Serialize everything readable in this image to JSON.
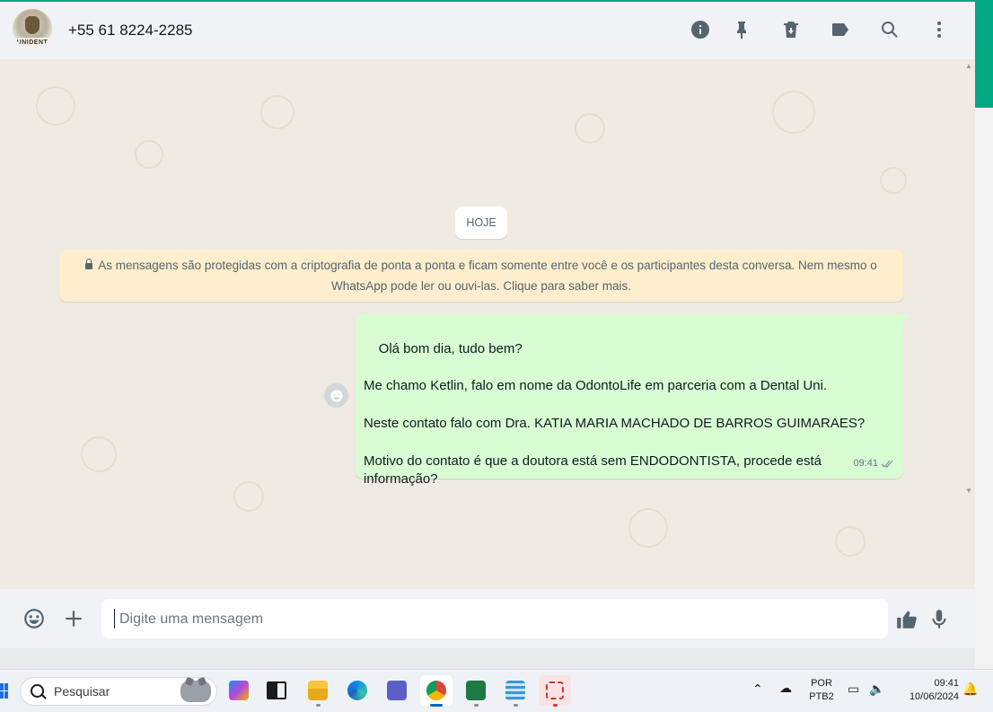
{
  "header": {
    "contact_name": "+55 61 8224-2285",
    "avatar_text": "UNIDENT",
    "icons": [
      "info-icon",
      "pin-icon",
      "delete-icon",
      "label-icon",
      "search-icon",
      "menu-icon"
    ]
  },
  "chat": {
    "day_label": "HOJE",
    "encryption_notice": "As mensagens são protegidas com a criptografia de ponta a ponta e ficam somente entre você e os participantes desta conversa. Nem mesmo o WhatsApp pode ler ou ouvi-las. Clique para saber mais.",
    "messages": [
      {
        "direction": "outgoing",
        "text": "Olá bom dia, tudo bem?\n\nMe chamo Ketlin, falo em nome da OdontoLife em parceria com a Dental Uni.\n\nNeste contato falo com Dra. KATIA MARIA MACHADO DE BARROS GUIMARAES?\n\nMotivo do contato é que a doutora está sem ENDODONTISTA, procede está informação?",
        "time": "09:41",
        "status": "read"
      }
    ]
  },
  "footer": {
    "placeholder": "Digite uma mensagem"
  },
  "taskbar": {
    "search_label": "Pesquisar",
    "apps": [
      "copilot",
      "task-view",
      "file-explorer",
      "edge",
      "teams",
      "chrome",
      "excel",
      "notepad",
      "snipping-tool"
    ],
    "active_app": "chrome",
    "lang_line1": "POR",
    "lang_line2": "PTB2",
    "time": "09:41",
    "date": "10/06/2024"
  },
  "colors": {
    "accent": "#00a884",
    "bubble_out": "#d9fdd3",
    "notice_bg": "#ffeecd",
    "chat_bg": "#efeae2"
  }
}
